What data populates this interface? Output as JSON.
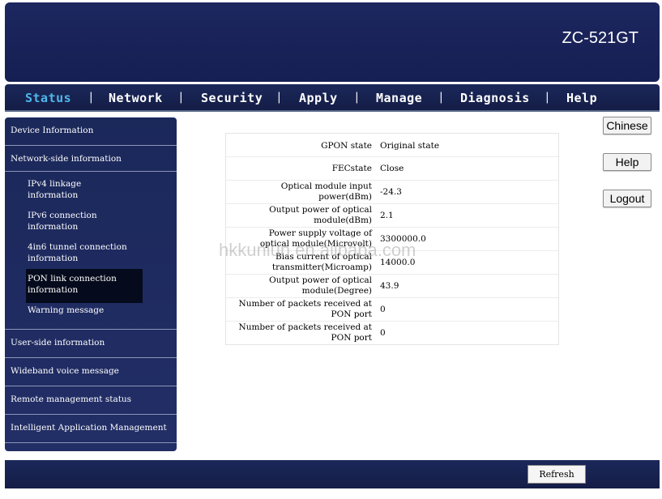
{
  "header": {
    "model": "ZC-521GT"
  },
  "nav": {
    "items": [
      {
        "label": "Status"
      },
      {
        "label": "Network"
      },
      {
        "label": "Security"
      },
      {
        "label": "Apply"
      },
      {
        "label": "Manage"
      },
      {
        "label": "Diagnosis"
      },
      {
        "label": "Help"
      }
    ],
    "separator": "|"
  },
  "sidebar": {
    "device_info": "Device Information",
    "network_side": "Network-side information",
    "sub": [
      {
        "line1": "IPv4 linkage",
        "line2": "information"
      },
      {
        "line1": "IPv6 connection",
        "line2": "information"
      },
      {
        "line1": "4in6 tunnel connection",
        "line2": "information"
      },
      {
        "line1": "PON link connection",
        "line2": "information"
      },
      {
        "line1": "Warning message",
        "line2": ""
      }
    ],
    "user_side": "User-side information",
    "wideband": "Wideband voice message",
    "remote": "Remote management status",
    "intelligent": "Intelligent Application Management"
  },
  "table": {
    "rows": [
      {
        "l1": "GPON state",
        "l2": "",
        "value": "Original state"
      },
      {
        "l1": "FECstate",
        "l2": "",
        "value": "Close"
      },
      {
        "l1": "Optical module input",
        "l2": "power(dBm)",
        "value": "-24.3"
      },
      {
        "l1": "Output power of optical",
        "l2": "module(dBm)",
        "value": "2.1"
      },
      {
        "l1": "Power supply voltage of",
        "l2": "optical module(Microvolt)",
        "value": "3300000.0"
      },
      {
        "l1": "Bias current of optical",
        "l2": "transmitter(Microamp)",
        "value": "14000.0"
      },
      {
        "l1": "Output power of optical",
        "l2": "module(Degree)",
        "value": "43.9"
      },
      {
        "l1": "Number of packets received at",
        "l2": "PON port",
        "value": "0"
      },
      {
        "l1": "Number of packets received at",
        "l2": "PON port",
        "value": "0"
      }
    ]
  },
  "side_buttons": {
    "chinese": "Chinese",
    "help": "Help",
    "logout": "Logout"
  },
  "footer": {
    "refresh": "Refresh"
  },
  "watermark": "hkkunlun.en.alibaba.com"
}
